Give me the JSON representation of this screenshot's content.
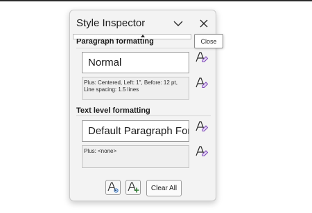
{
  "pane": {
    "title": "Style Inspector",
    "close_tooltip": "Close"
  },
  "paragraph": {
    "section_label": "Paragraph formatting",
    "style_name": "Normal",
    "description_line1": "Plus: Centered, Left:  1\", Before:  12 pt,",
    "description_line2": "Line spacing:  1.5 lines"
  },
  "text_level": {
    "section_label": "Text level formatting",
    "style_name": "Default Paragraph Font",
    "description": "Plus: <none>"
  },
  "footer": {
    "clear_all_label": "Clear All"
  },
  "icons": {
    "minimize": "chevron-down-icon",
    "close": "close-icon",
    "clear_style": "clear-formatting-icon",
    "reveal_formatting": "reveal-formatting-icon",
    "new_style": "new-style-icon"
  },
  "colors": {
    "accent_purple": "#7a45b5",
    "accent_green": "#2e7d32",
    "panel_bg": "#f3f3f3"
  }
}
